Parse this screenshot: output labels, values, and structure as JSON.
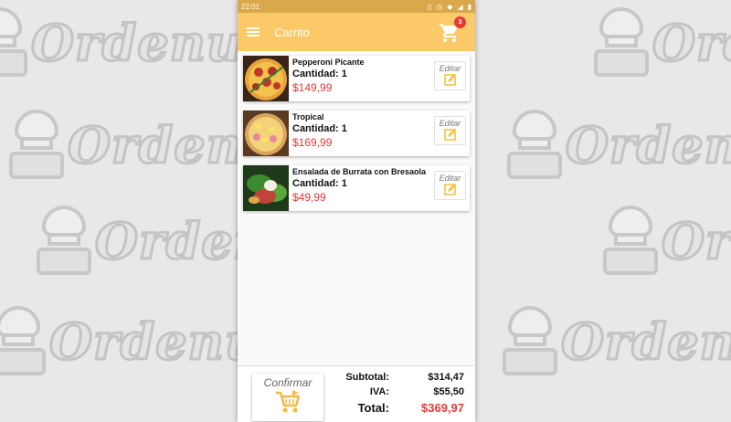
{
  "background": {
    "watermark_text": "Ordenus"
  },
  "status_bar": {
    "time": "22:01",
    "icons": [
      "vibrate-icon",
      "alarm-icon",
      "wifi-icon",
      "signal-icon",
      "battery-icon"
    ]
  },
  "app_bar": {
    "title": "Carrito",
    "cart_count": "3",
    "color": "#fbc968"
  },
  "cart_items": [
    {
      "name": "Pepperoni Picante",
      "quantity": "Cantidad: 1",
      "price": "$149,99",
      "edit_label": "Editar"
    },
    {
      "name": "Tropical",
      "quantity": "Cantidad: 1",
      "price": "$169,99",
      "edit_label": "Editar"
    },
    {
      "name": "Ensalada de Burrata con Bresaola",
      "quantity": "Cantidad: 1",
      "price": "$49,99",
      "edit_label": "Editar"
    }
  ],
  "footer": {
    "confirm_label": "Confirmar",
    "subtotal_label": "Subtotal:",
    "subtotal_value": "$314,47",
    "iva_label": "IVA:",
    "iva_value": "$55,50",
    "total_label": "Total:",
    "total_value": "$369,97"
  },
  "colors": {
    "accent": "#fbc968",
    "price": "#e53935"
  }
}
